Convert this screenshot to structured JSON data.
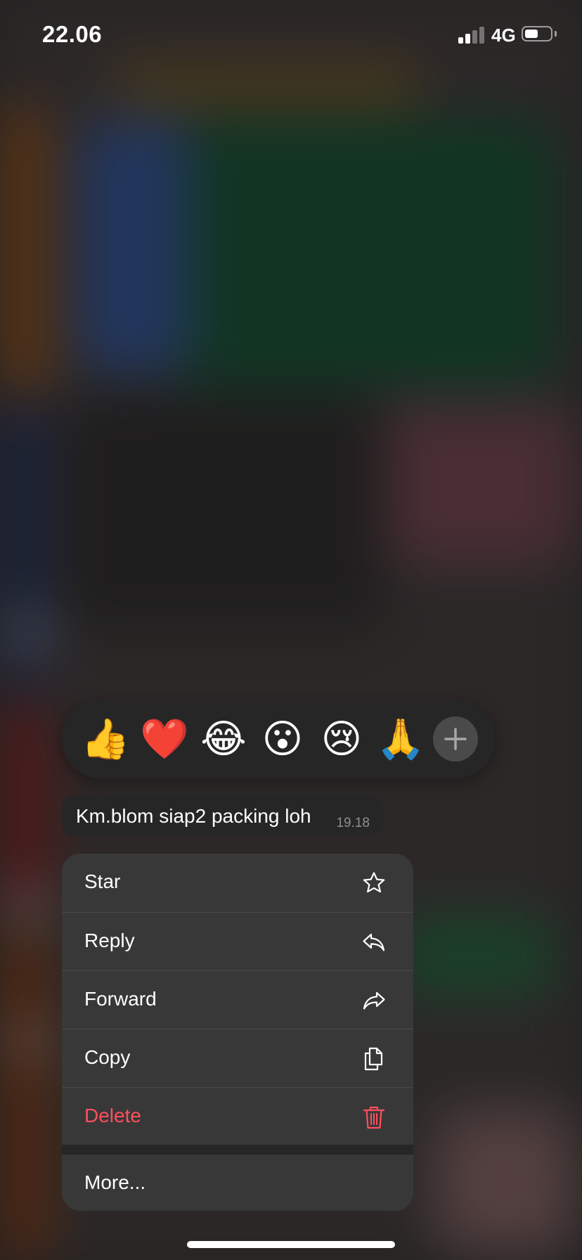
{
  "status_bar": {
    "time": "22.06",
    "network": "4G",
    "signal_bars_active": 2,
    "signal_bars_total": 4,
    "battery_level": 0.55
  },
  "reactions": {
    "emojis": [
      {
        "glyph": "👍",
        "name": "thumbs-up"
      },
      {
        "glyph": "❤️",
        "name": "red-heart"
      },
      {
        "glyph": "😂",
        "name": "tears-of-joy"
      },
      {
        "glyph": "😮",
        "name": "surprised"
      },
      {
        "glyph": "😢",
        "name": "crying"
      },
      {
        "glyph": "🙏",
        "name": "folded-hands"
      }
    ],
    "more_icon": "plus-icon"
  },
  "message": {
    "text": "Km.blom siap2 packing loh",
    "time": "19.18"
  },
  "menu": {
    "items": [
      {
        "label": "Star",
        "icon": "star-icon"
      },
      {
        "label": "Reply",
        "icon": "reply-icon"
      },
      {
        "label": "Forward",
        "icon": "forward-icon"
      },
      {
        "label": "Copy",
        "icon": "copy-icon"
      },
      {
        "label": "Delete",
        "icon": "trash-icon"
      }
    ],
    "more_label": "More..."
  },
  "colors": {
    "menu_background": "#383838",
    "bubble_background": "#262626",
    "danger": "#ff4f5e"
  }
}
